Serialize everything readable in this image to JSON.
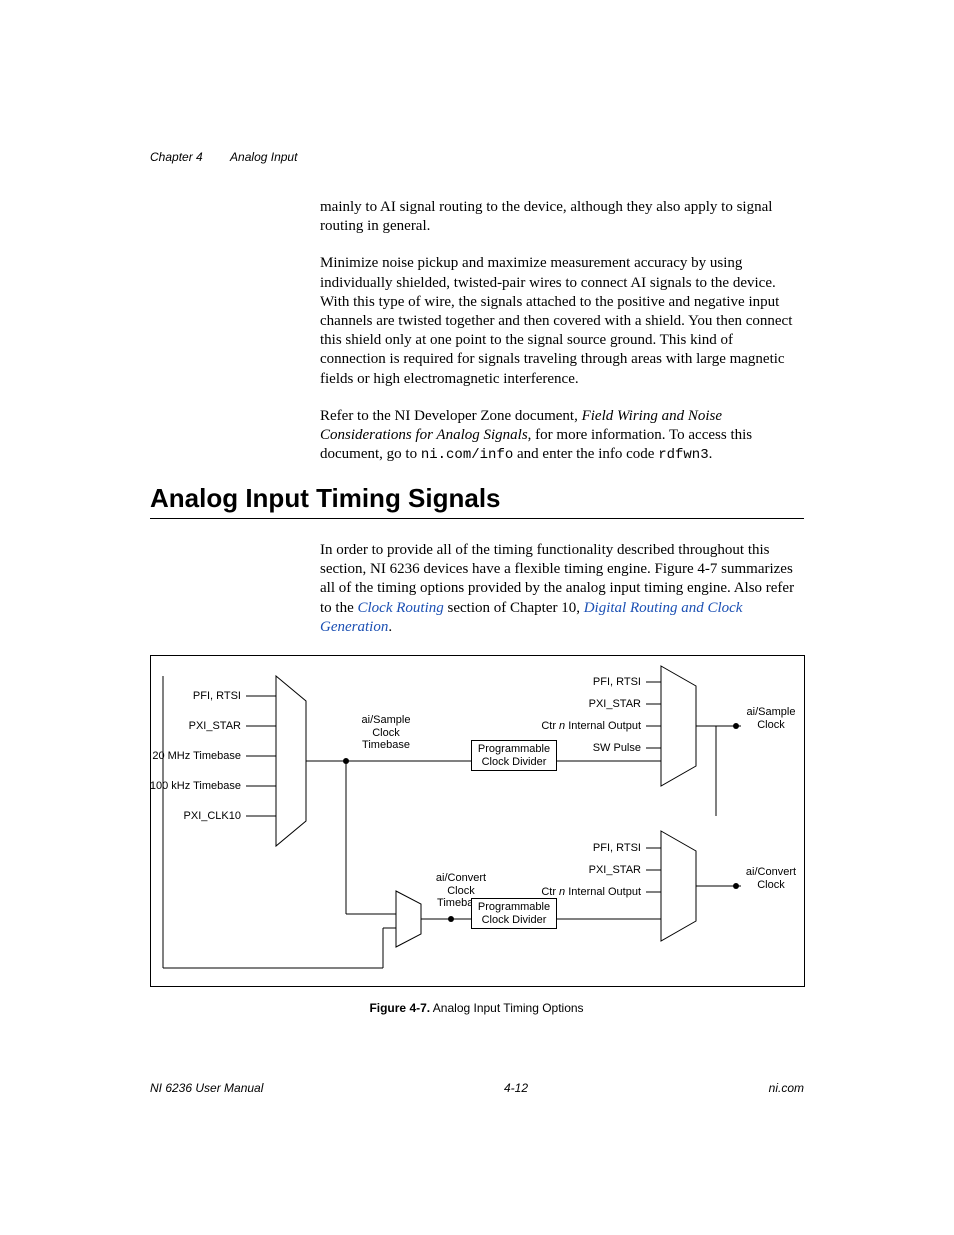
{
  "header": {
    "chapter": "Chapter 4",
    "title": "Analog Input"
  },
  "body": {
    "para1": "mainly to AI signal routing to the device, although they also apply to signal routing in general.",
    "para2": "Minimize noise pickup and maximize measurement accuracy by using individually shielded, twisted-pair wires to connect AI signals to the device. With this type of wire, the signals attached to the positive and negative input channels are twisted together and then covered with a shield. You then connect this shield only at one point to the signal source ground. This kind of connection is required for signals traveling through areas with large magnetic fields or high electromagnetic interference.",
    "para3a": "Refer to the NI Developer Zone document, ",
    "para3_ital": "Field Wiring and Noise Considerations for Analog Signals",
    "para3b": ", for more information. To access this document, go to ",
    "para3_code1": "ni.com/info",
    "para3c": " and enter the info code ",
    "para3_code2": "rdfwn3",
    "para3d": "."
  },
  "heading": "Analog Input Timing Signals",
  "intro": {
    "t1": "In order to provide all of the timing functionality described throughout this section, NI 6236 devices have a flexible timing engine. Figure 4-7 summarizes all of the timing options provided by the analog input timing engine. Also refer to the ",
    "link1": "Clock Routing",
    "t2": " section of Chapter 10, ",
    "link2": "Digital Routing and Clock Generation",
    "t3": "."
  },
  "figure": {
    "mux1_inputs": [
      "PFI, RTSI",
      "PXI_STAR",
      "20 MHz Timebase",
      "100 kHz Timebase",
      "PXI_CLK10"
    ],
    "mux1_out": "ai/Sample\nClock\nTimebase",
    "box1": "Programmable\nClock\nDivider",
    "mux2_inputs_a": "PFI, RTSI",
    "mux2_inputs_b": "PXI_STAR",
    "mux2_inputs_c_pre": "Ctr ",
    "mux2_inputs_c_ital": "n",
    "mux2_inputs_c_post": " Internal Output",
    "mux2_inputs_d": "SW Pulse",
    "mux2_out": "ai/Sample\nClock",
    "mux3_out_label": "ai/Convert\nClock\nTimebase",
    "box2": "Programmable\nClock\nDivider",
    "mux4_inputs_a": "PFI, RTSI",
    "mux4_inputs_b": "PXI_STAR",
    "mux4_inputs_c_pre": "Ctr ",
    "mux4_inputs_c_ital": "n",
    "mux4_inputs_c_post": " Internal Output",
    "mux4_out": "ai/Convert\nClock",
    "caption_b": "Figure 4-7.",
    "caption_r": "  Analog Input Timing Options"
  },
  "footer": {
    "left": "NI 6236 User Manual",
    "center": "4-12",
    "right": "ni.com"
  }
}
